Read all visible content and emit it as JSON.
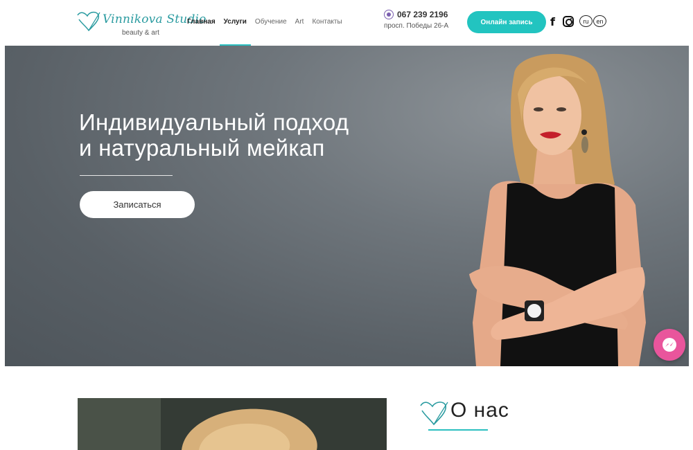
{
  "brand": {
    "title": "Vinnikova Studio",
    "subtitle": "beauty & art",
    "accent": "#2bbfc0"
  },
  "nav": {
    "items": [
      {
        "label": "Главная"
      },
      {
        "label": "Услуги"
      },
      {
        "label": "Обучение"
      },
      {
        "label": "Art"
      },
      {
        "label": "Контакты"
      }
    ],
    "active_index": 1
  },
  "contact": {
    "phone": "067 239 2196",
    "address": "просп. Победы 26-А",
    "phone_icon": "viber-icon"
  },
  "header_actions": {
    "book_label": "Онлайн запись",
    "social": [
      "facebook-icon",
      "instagram-icon"
    ],
    "languages": [
      "ru",
      "en"
    ]
  },
  "hero": {
    "title_line1": "Индивидуальный подход",
    "title_line2": "и натуральный мейкап",
    "button_label": "Записаться",
    "chat_icon": "messenger-icon"
  },
  "about": {
    "title": "О нас"
  }
}
